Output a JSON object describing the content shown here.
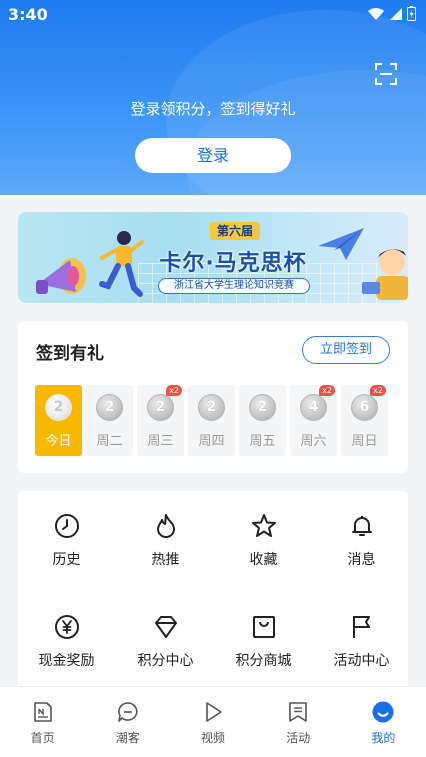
{
  "status_bar": {
    "time": "3:40"
  },
  "header": {
    "login_tip": "登录领积分，签到得好礼",
    "login_button": "登录",
    "scan_icon": "scan-icon"
  },
  "banner": {
    "edition": "第六届",
    "title": "卡尔·马克思杯",
    "subtitle": "浙江省大学生理论知识竞赛"
  },
  "signin": {
    "title": "签到有礼",
    "button": "立即签到",
    "days": [
      {
        "points": "2",
        "label": "今日",
        "badge": ""
      },
      {
        "points": "2",
        "label": "周二",
        "badge": ""
      },
      {
        "points": "2",
        "label": "周三",
        "badge": "x2"
      },
      {
        "points": "2",
        "label": "周四",
        "badge": ""
      },
      {
        "points": "2",
        "label": "周五",
        "badge": ""
      },
      {
        "points": "4",
        "label": "周六",
        "badge": "x2"
      },
      {
        "points": "6",
        "label": "周日",
        "badge": "x2"
      }
    ]
  },
  "grid": {
    "items": [
      {
        "label": "历史",
        "icon": "clock-icon"
      },
      {
        "label": "热推",
        "icon": "flame-icon"
      },
      {
        "label": "收藏",
        "icon": "star-icon"
      },
      {
        "label": "消息",
        "icon": "bell-icon"
      },
      {
        "label": "现金奖励",
        "icon": "yuan-icon"
      },
      {
        "label": "积分中心",
        "icon": "diamond-icon"
      },
      {
        "label": "积分商城",
        "icon": "shopping-bag-icon"
      },
      {
        "label": "活动中心",
        "icon": "flag-icon"
      }
    ]
  },
  "tabbar": {
    "items": [
      {
        "label": "首页",
        "icon": "news-icon",
        "active": false
      },
      {
        "label": "潮客",
        "icon": "chat-icon",
        "active": false
      },
      {
        "label": "视频",
        "icon": "play-icon",
        "active": false
      },
      {
        "label": "活动",
        "icon": "bookmark-icon",
        "active": false
      },
      {
        "label": "我的",
        "icon": "profile-icon",
        "active": true
      }
    ]
  },
  "colors": {
    "accent": "#1e6fe6",
    "today": "#f7b800",
    "badge": "#f0504a"
  }
}
